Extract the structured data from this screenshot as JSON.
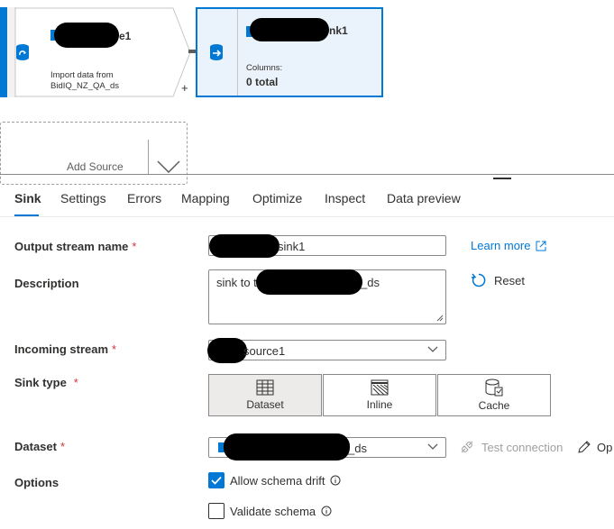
{
  "canvas": {
    "source_node": {
      "title_suffix": "e1",
      "subtitle_line1": "Import data from",
      "subtitle_line2": "BidIQ_NZ_QA_ds"
    },
    "sink_node": {
      "title_suffix": "nk1",
      "columns_label": "Columns:",
      "columns_value": "0 total"
    },
    "plus": "+",
    "add_source": {
      "label": "Add Source"
    }
  },
  "tabs": [
    {
      "label": "Sink"
    },
    {
      "label": "Settings"
    },
    {
      "label": "Errors"
    },
    {
      "label": "Mapping"
    },
    {
      "label": "Optimize"
    },
    {
      "label": "Inspect"
    },
    {
      "label": "Data preview"
    }
  ],
  "form": {
    "output_stream": {
      "label": "Output stream name",
      "required": "*",
      "value": "sink1"
    },
    "learn_more": "Learn more",
    "description": {
      "label": "Description",
      "value_prefix": "sink to t",
      "value_suffix": "_ds"
    },
    "reset": "Reset",
    "incoming_stream": {
      "label": "Incoming stream",
      "required": "*",
      "value": "source1"
    },
    "sink_type": {
      "label": "Sink type",
      "required": "*",
      "options": [
        {
          "label": "Dataset",
          "selected": true
        },
        {
          "label": "Inline",
          "selected": false
        },
        {
          "label": "Cache",
          "selected": false
        }
      ]
    },
    "dataset": {
      "label": "Dataset",
      "required": "*",
      "value": "_ds"
    },
    "test_connection": "Test connection",
    "open": "Op",
    "options": {
      "label": "Options",
      "allow_schema_drift": {
        "label": "Allow schema drift",
        "checked": true
      },
      "validate_schema": {
        "label": "Validate schema",
        "checked": false
      }
    }
  },
  "colors": {
    "accent": "#0078d4",
    "required": "#d13438"
  }
}
